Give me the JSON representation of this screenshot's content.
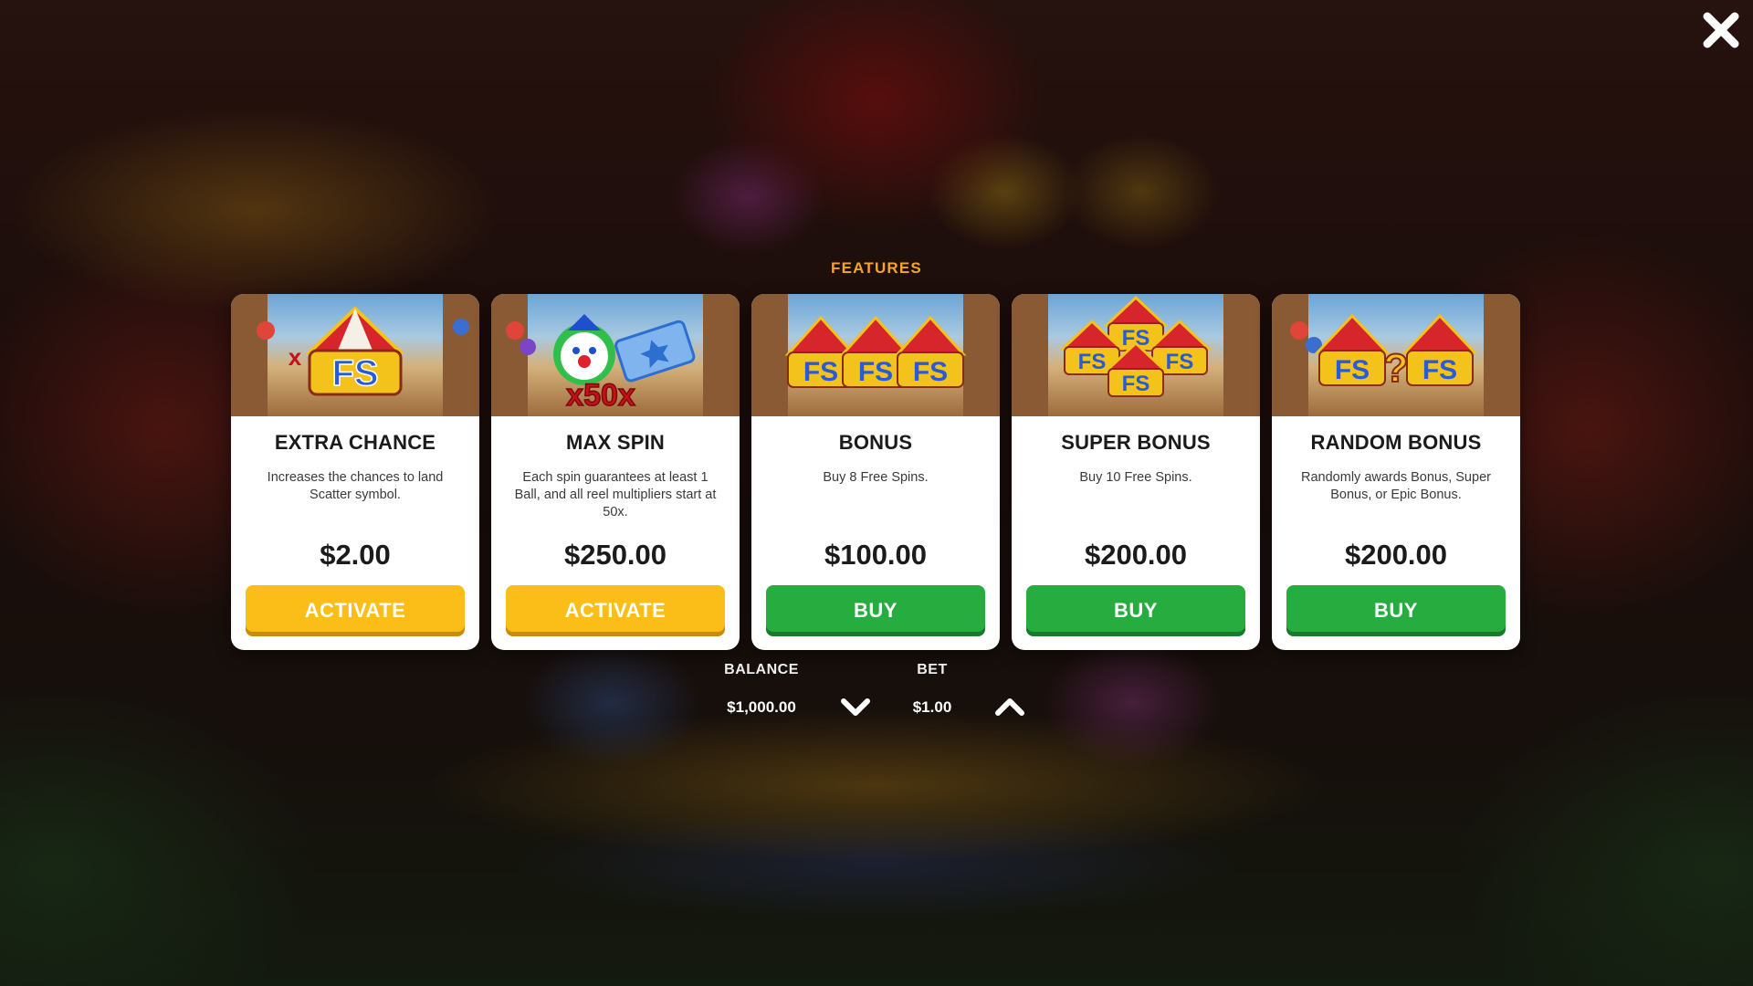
{
  "dialog": {
    "title": "FEATURES",
    "close_icon": "close-icon"
  },
  "cards": [
    {
      "name": "EXTRA CHANCE",
      "description": "Increases the chances to land Scatter symbol.",
      "price": "$2.00",
      "button": "ACTIVATE",
      "button_color": "#fbbd18",
      "art_icon": "fs-tent-multiplier-icon",
      "art_text": "FS"
    },
    {
      "name": "MAX SPIN",
      "description": "Each spin guarantees at least 1 Ball, and all reel multipliers start at 50x.",
      "price": "$250.00",
      "button": "ACTIVATE",
      "button_color": "#fbbd18",
      "art_icon": "clown-ticket-icon",
      "art_text": "x50x"
    },
    {
      "name": "BONUS",
      "description": "Buy 8 Free Spins.",
      "price": "$100.00",
      "button": "BUY",
      "button_color": "#27ad3f",
      "art_icon": "three-fs-tents-icon",
      "art_text": "FS"
    },
    {
      "name": "SUPER BONUS",
      "description": "Buy 10 Free Spins.",
      "price": "$200.00",
      "button": "BUY",
      "button_color": "#27ad3f",
      "art_icon": "four-fs-tents-icon",
      "art_text": "FS"
    },
    {
      "name": "RANDOM BONUS",
      "description": "Randomly awards Bonus, Super Bonus, or Epic Bonus.",
      "price": "$200.00",
      "button": "BUY",
      "button_color": "#27ad3f",
      "art_icon": "fs-question-tents-icon",
      "art_text": "FS?FS"
    }
  ],
  "footer": {
    "balance_label": "BALANCE",
    "balance_value": "$1,000.00",
    "bet_label": "BET",
    "bet_value": "$1.00",
    "decrease_icon": "chevron-down-icon",
    "increase_icon": "chevron-up-icon"
  },
  "colors": {
    "title": "#f5a623",
    "activate": "#fbbd18",
    "buy": "#27ad3f"
  }
}
